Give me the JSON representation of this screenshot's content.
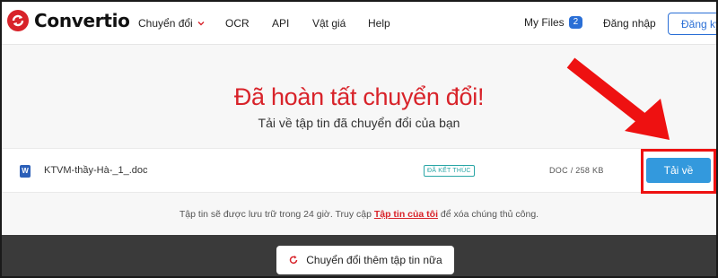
{
  "header": {
    "brand": "Convertio",
    "nav": {
      "convert": "Chuyển đổi",
      "ocr": "OCR",
      "api": "API",
      "pricing": "Vật giá",
      "help": "Help"
    },
    "my_files": "My Files",
    "my_files_count": "2",
    "login": "Đăng nhập",
    "register": "Đăng ký"
  },
  "main": {
    "headline": "Đã hoàn tất chuyển đổi!",
    "subline": "Tải về tập tin đã chuyển đổi của bạn",
    "file": {
      "icon_label": "W",
      "name": "KTVM-thầy-Hà-_1_.doc",
      "status": "ĐÃ KẾT THÚC",
      "size": "DOC / 258 KB",
      "download_label": "Tải về"
    },
    "notice": {
      "before": "Tập tin sẽ được lưu trữ trong 24 giờ. Truy cập ",
      "link": "Tập tin của tôi",
      "after": " để xóa chúng thủ công."
    },
    "convert_more": "Chuyển đổi thêm tập tin nữa"
  },
  "colors": {
    "brand_red": "#d8232a",
    "download_blue": "#3399dd",
    "status_teal": "#2aa6a6",
    "annotation_red": "#ee1111"
  },
  "icons": [
    "convertio-logo-icon",
    "chevron-down-icon",
    "word-doc-icon",
    "refresh-icon",
    "arrow-annotation-icon"
  ]
}
